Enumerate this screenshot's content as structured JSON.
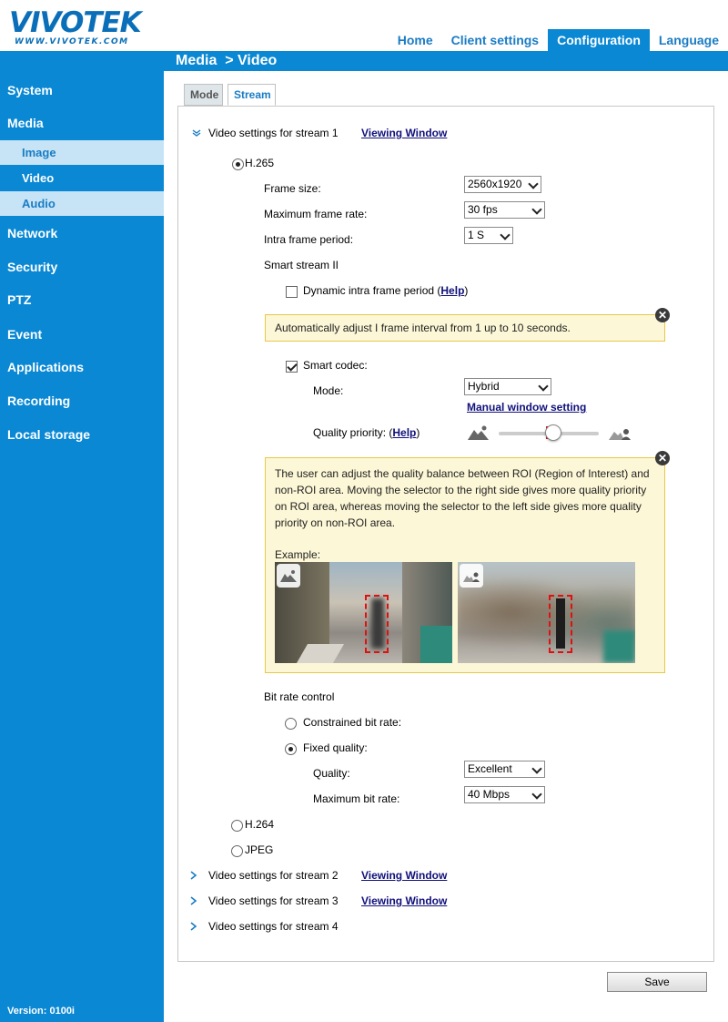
{
  "header": {
    "logo_text": "VIVOTEK",
    "logo_url": "WWW.VIVOTEK.COM",
    "nav": [
      {
        "label": "Home"
      },
      {
        "label": "Client settings"
      },
      {
        "label": "Configuration"
      },
      {
        "label": "Language"
      }
    ],
    "active_nav": "Configuration",
    "page_title": "Media  > Video"
  },
  "sidebar": {
    "items": [
      {
        "label": "System"
      },
      {
        "label": "Media"
      },
      {
        "label": "Image"
      },
      {
        "label": "Video"
      },
      {
        "label": "Audio"
      },
      {
        "label": "Network"
      },
      {
        "label": "Security"
      },
      {
        "label": "PTZ"
      },
      {
        "label": "Event"
      },
      {
        "label": "Applications"
      },
      {
        "label": "Recording"
      },
      {
        "label": "Local storage"
      }
    ],
    "version": "Version: 0100i"
  },
  "tabs": [
    {
      "label": "Mode"
    },
    {
      "label": "Stream"
    }
  ],
  "stream1": {
    "title": "Video settings for stream 1",
    "viewing_window": "Viewing Window",
    "codec_h265": "H.265",
    "frame_size_label": "Frame size:",
    "frame_size_value": "2560x1920",
    "max_frame_rate_label": "Maximum frame rate:",
    "max_frame_rate_value": "30 fps",
    "intra_frame_label": "Intra frame period:",
    "intra_frame_value": "1 S",
    "smart_stream_label": "Smart stream II",
    "dynamic_intra_label": "Dynamic intra frame period (",
    "help_link": "Help",
    "close_paren": ")",
    "note1": "Automatically adjust I frame interval from 1 up to 10 seconds.",
    "smart_codec_label": "Smart codec:",
    "mode_label": "Mode:",
    "mode_value": "Hybrid",
    "manual_window": "Manual window setting",
    "quality_priority_label": "Quality priority: (",
    "note2": "The user can adjust the quality balance between ROI (Region of Interest) and non-ROI area. Moving the selector to the right side gives more quality priority on ROI area, whereas moving the selector to the left side gives more quality priority on non-ROI area.",
    "example_label": "Example:",
    "bit_rate_control": "Bit rate control",
    "constrained": "Constrained bit rate:",
    "fixed_quality": "Fixed quality:",
    "quality_label": "Quality:",
    "quality_value": "Excellent",
    "max_bit_rate_label": "Maximum bit rate:",
    "max_bit_rate_value": "40 Mbps",
    "codec_h264": "H.264",
    "codec_jpeg": "JPEG"
  },
  "other_streams": [
    {
      "title": "Video settings for stream 2",
      "viewing_window": "Viewing Window"
    },
    {
      "title": "Video settings for stream 3",
      "viewing_window": "Viewing Window"
    },
    {
      "title": "Video settings for stream 4"
    }
  ],
  "save_label": "Save",
  "colors": {
    "accent": "#0a88d4",
    "link": "#10107a",
    "note_bg": "#fcf7d6"
  }
}
